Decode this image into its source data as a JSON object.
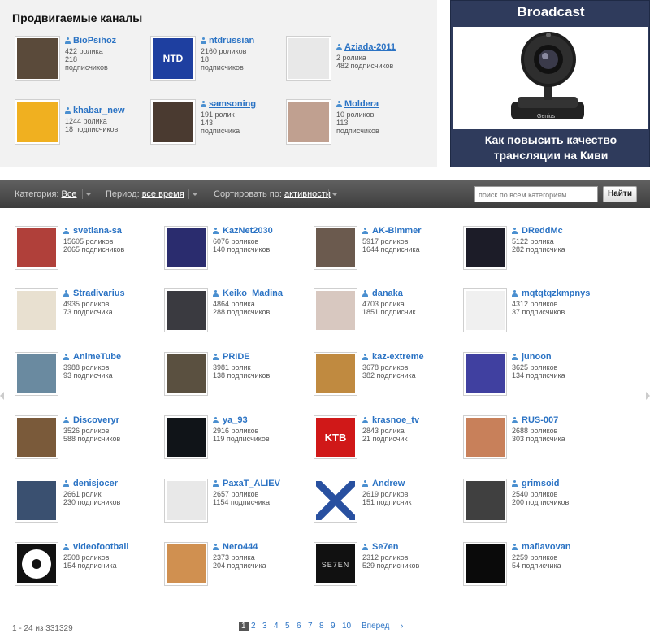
{
  "promoted": {
    "title": "Продвигаемые каналы",
    "channels": [
      {
        "name": "BioPsihoz",
        "videos": "422 ролика",
        "subs": "218",
        "subs_label": "подписчиков",
        "underline": false,
        "stats_lines": 3
      },
      {
        "name": "ntdrussian",
        "videos": "2160 роликов",
        "subs": "18",
        "subs_label": "подписчиков",
        "underline": false,
        "stats_lines": 3
      },
      {
        "name": "Aziada-2011",
        "videos": "2 ролика",
        "subs": "482 подписчиков",
        "underline": true,
        "stats_lines": 2
      },
      {
        "name": "khabar_new",
        "videos": "1244 ролика",
        "subs": "18 подписчиков",
        "underline": false,
        "stats_lines": 2
      },
      {
        "name": "samsoning",
        "videos": "191 ролик",
        "subs": "143",
        "subs_label": "подписчика",
        "underline": true,
        "stats_lines": 3
      },
      {
        "name": "Moldera",
        "videos": "10 роликов",
        "subs": "113",
        "subs_label": "подписчиков",
        "underline": true,
        "stats_lines": 3
      }
    ]
  },
  "broadcast": {
    "title": "Broadcast",
    "text_line1": "Как повысить качество",
    "text_line2": "трансляции на Киви",
    "camera_brand": "Genius"
  },
  "filters": {
    "category_label": "Категория:",
    "category_value": "Все",
    "period_label": "Период:",
    "period_value": "все время",
    "sort_label": "Сортировать по:",
    "sort_value": "активности",
    "search_placeholder": "поиск по всем категориям",
    "search_button": "Найти"
  },
  "channels": [
    {
      "name": "svetlana-sa",
      "videos": "15605 роликов",
      "subs": "2065 подписчиков"
    },
    {
      "name": "KazNet2030",
      "videos": "6076 роликов",
      "subs": "140 подписчиков"
    },
    {
      "name": "AK-Bimmer",
      "videos": "5917 роликов",
      "subs": "1644 подписчика"
    },
    {
      "name": "DReddMc",
      "videos": "5122 ролика",
      "subs": "282 подписчика"
    },
    {
      "name": "Stradivarius",
      "videos": "4935 роликов",
      "subs": "73 подписчика"
    },
    {
      "name": "Keiko_Madina",
      "videos": "4864 ролика",
      "subs": "288 подписчиков"
    },
    {
      "name": "danaka",
      "videos": "4703 ролика",
      "subs": "1851 подписчик"
    },
    {
      "name": "mqtqtqzkmpnys",
      "videos": "4312 роликов",
      "subs": "37 подписчиков"
    },
    {
      "name": "AnimeTube",
      "videos": "3988 роликов",
      "subs": "93 подписчика"
    },
    {
      "name": "PRIDE",
      "videos": "3981 ролик",
      "subs": "138 подписчиков"
    },
    {
      "name": "kaz-extreme",
      "videos": "3678 роликов",
      "subs": "382 подписчика"
    },
    {
      "name": "junoon",
      "videos": "3625 роликов",
      "subs": "134 подписчика"
    },
    {
      "name": "Discoveryr",
      "videos": "3526 роликов",
      "subs": "588 подписчиков"
    },
    {
      "name": "ya_93",
      "videos": "2916 роликов",
      "subs": "119 подписчиков"
    },
    {
      "name": "krasnoe_tv",
      "videos": "2843 ролика",
      "subs": "21 подписчик"
    },
    {
      "name": "RUS-007",
      "videos": "2688 роликов",
      "subs": "303 подписчика"
    },
    {
      "name": "denisjocer",
      "videos": "2661 ролик",
      "subs": "230 подписчиков"
    },
    {
      "name": "PaxaT_ALIEV",
      "videos": "2657 роликов",
      "subs": "1154 подписчика"
    },
    {
      "name": "Andrew",
      "videos": "2619 роликов",
      "subs": "151 подписчик"
    },
    {
      "name": "grimsoid",
      "videos": "2540 роликов",
      "subs": "200 подписчиков"
    },
    {
      "name": "videofootball",
      "videos": "2508 роликов",
      "subs": "154 подписчика"
    },
    {
      "name": "Nero444",
      "videos": "2373 ролика",
      "subs": "204 подписчика"
    },
    {
      "name": "Se7en",
      "videos": "2312 роликов",
      "subs": "529 подписчиков"
    },
    {
      "name": "mafiavovan",
      "videos": "2259 роликов",
      "subs": "54 подписчика"
    }
  ],
  "thumb_colors": [
    "#b0403a",
    "#2a2c6e",
    "#6b5a4e",
    "#1c1c28",
    "#e8e0d0",
    "#3a3a40",
    "#d8c8c0",
    "#f0f0f0",
    "#6a8aa0",
    "#5a5040",
    "#c08a40",
    "#4040a0",
    "#7a5a3a",
    "#101418",
    "#d01818",
    "#c8805a",
    "#3a5070",
    "#e8e8e8",
    "#2850a0",
    "#404040",
    "#202020",
    "#d09050",
    "#111111",
    "#0a0a0a"
  ],
  "thumb_art": {
    "tv8": "KTB",
    "seven": "SE7EN",
    "ntd": "NTD"
  },
  "pager": {
    "count": "1 - 24 из 331329",
    "pages": [
      "1",
      "2",
      "3",
      "4",
      "5",
      "6",
      "7",
      "8",
      "9",
      "10"
    ],
    "next": "Вперед",
    "next_arrow": "›"
  }
}
